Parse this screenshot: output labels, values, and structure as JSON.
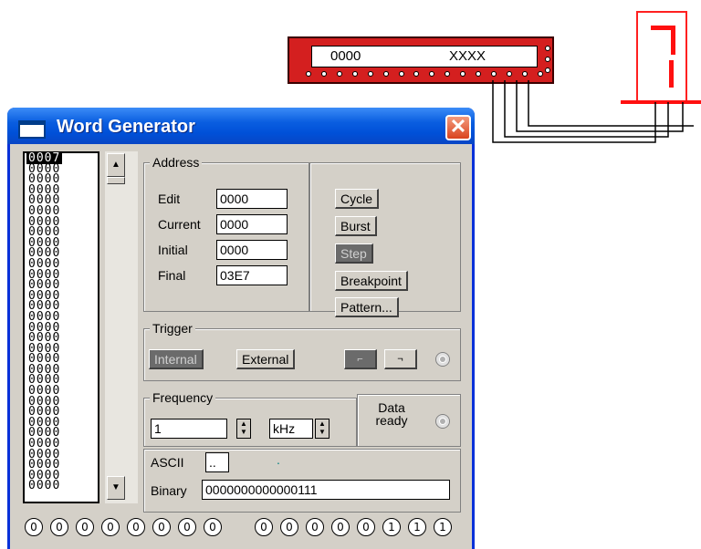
{
  "chip": {
    "display_left": "0000",
    "display_right": "XXXX"
  },
  "window": {
    "title": "Word Generator",
    "close": "✕"
  },
  "words": [
    "0007",
    "0000",
    "0000",
    "0000",
    "0000",
    "0000",
    "0000",
    "0000",
    "0000",
    "0000",
    "0000",
    "0000",
    "0000",
    "0000",
    "0000",
    "0000",
    "0000",
    "0000",
    "0000",
    "0000",
    "0000",
    "0000",
    "0000",
    "0000",
    "0000",
    "0000",
    "0000",
    "0000",
    "0000",
    "0000",
    "0000",
    "0000"
  ],
  "address": {
    "group_label": "Address",
    "edit_label": "Edit",
    "edit_value": "0000",
    "current_label": "Current",
    "current_value": "0000",
    "initial_label": "Initial",
    "initial_value": "0000",
    "final_label": "Final",
    "final_value": "03E7"
  },
  "controls": {
    "cycle": "Cycle",
    "burst": "Burst",
    "step": "Step",
    "breakpoint": "Breakpoint",
    "pattern": "Pattern..."
  },
  "trigger": {
    "group_label": "Trigger",
    "internal": "Internal",
    "external": "External"
  },
  "frequency": {
    "group_label": "Frequency",
    "value": "1",
    "unit": "kHz",
    "data_ready_1": "Data",
    "data_ready_2": "ready"
  },
  "ascii": {
    "label": "ASCII",
    "value": "..",
    "dot": "."
  },
  "binary": {
    "label": "Binary",
    "value": "0000000000000111"
  },
  "bits": [
    "0",
    "0",
    "0",
    "0",
    "0",
    "0",
    "0",
    "0",
    "0",
    "0",
    "0",
    "0",
    "0",
    "1",
    "1",
    "1"
  ]
}
